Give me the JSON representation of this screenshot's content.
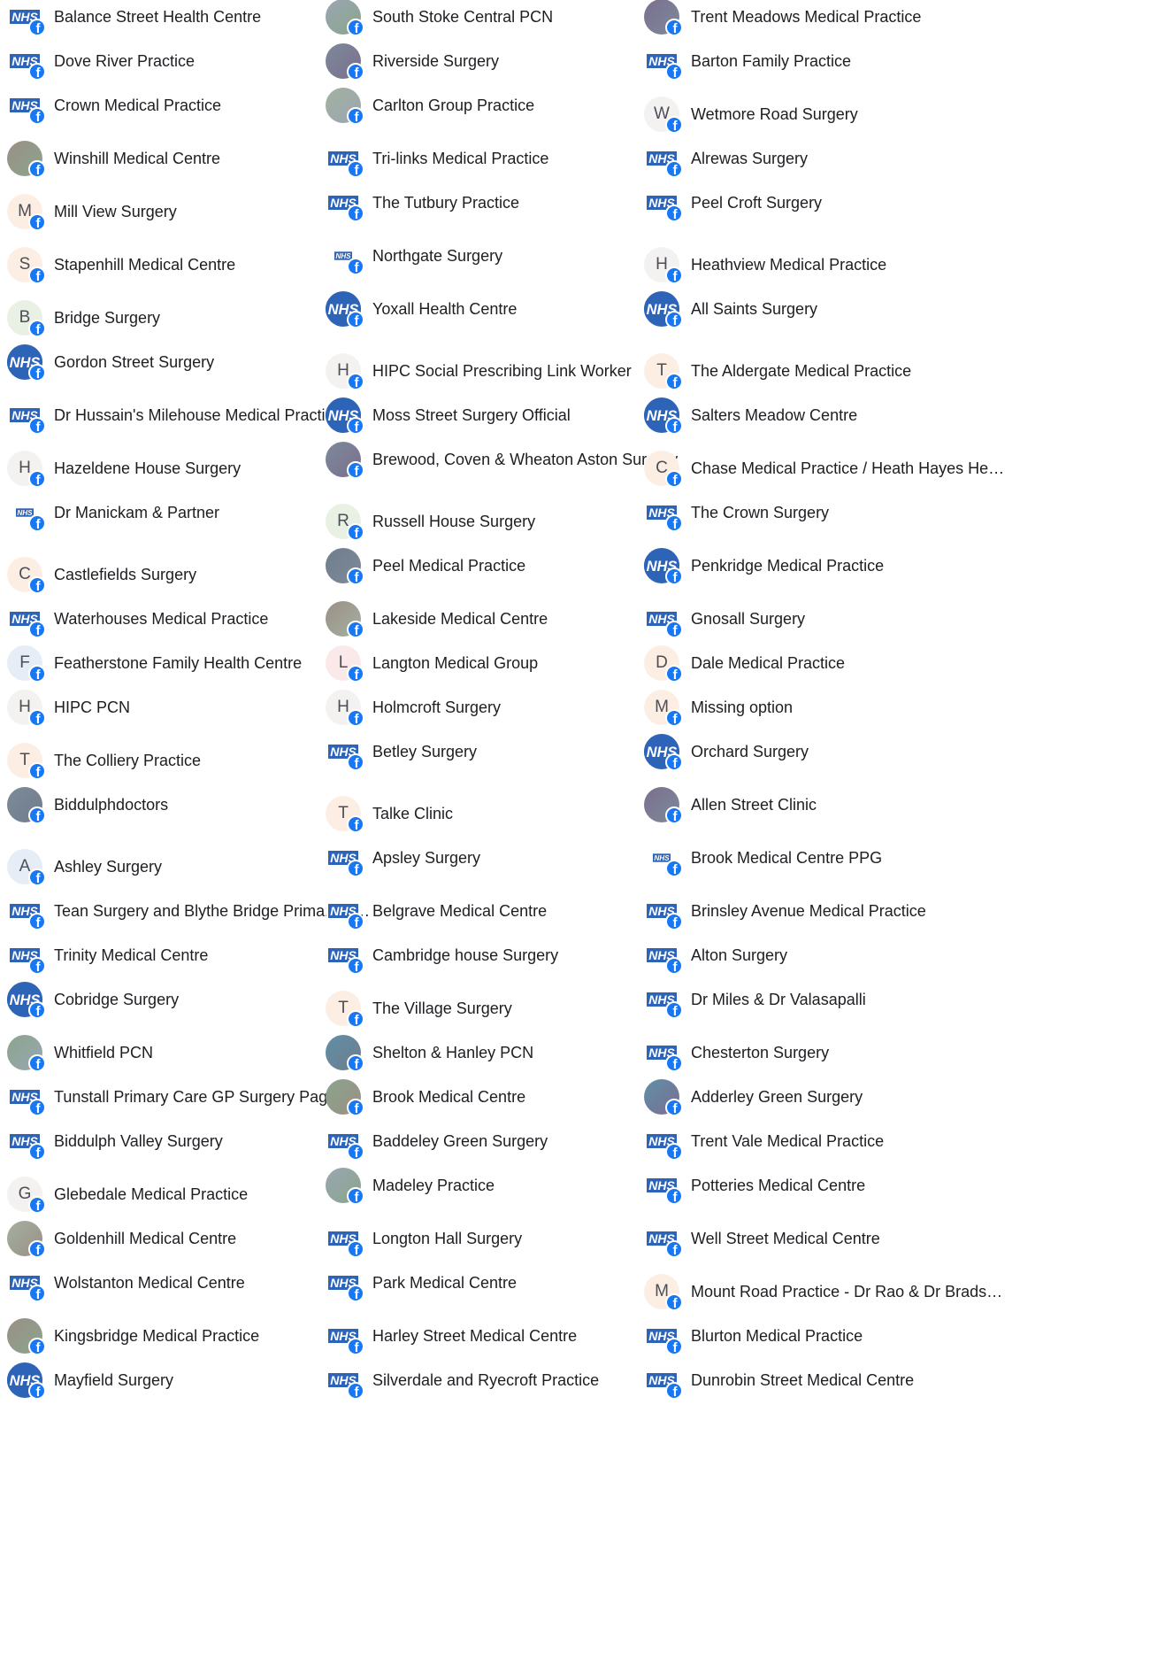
{
  "columns": [
    {
      "items": [
        {
          "label": "Balance Street Health Centre",
          "avatar": "nhs"
        },
        {
          "label": "Dove River Practice",
          "avatar": "nhs"
        },
        {
          "label": "Crown Medical Practice",
          "avatar": "nhs"
        },
        {
          "label": "Winshill Medical Centre",
          "avatar": "photo"
        },
        {
          "label": "Mill View Surgery",
          "avatar": "letter",
          "letter": "M",
          "tone": "warm"
        },
        {
          "label": "Stapenhill Medical Centre",
          "avatar": "letter",
          "letter": "S",
          "tone": "warm"
        },
        {
          "label": "Bridge Surgery",
          "avatar": "letter",
          "letter": "B",
          "tone": "green"
        },
        {
          "label": "Gordon Street Surgery",
          "avatar": "nhs-round"
        },
        {
          "label": "Dr Hussain's Milehouse Medical Practice",
          "avatar": "nhs"
        },
        {
          "label": "Hazeldene House Surgery",
          "avatar": "letter",
          "letter": "H",
          "tone": "grey"
        },
        {
          "label": "Dr Manickam & Partner",
          "avatar": "nhs-small"
        },
        {
          "label": "Castlefields Surgery",
          "avatar": "letter",
          "letter": "C",
          "tone": "warm"
        },
        {
          "label": "Waterhouses Medical Practice",
          "avatar": "nhs"
        },
        {
          "label": "Featherstone Family Health Centre",
          "avatar": "letter",
          "letter": "F",
          "tone": "blue"
        },
        {
          "label": "HIPC PCN",
          "avatar": "letter",
          "letter": "H",
          "tone": "grey"
        },
        {
          "label": "The Colliery Practice",
          "avatar": "letter",
          "letter": "T",
          "tone": "warm"
        },
        {
          "label": "Biddulphdoctors",
          "avatar": "photo"
        },
        {
          "label": "Ashley Surgery",
          "avatar": "letter",
          "letter": "A",
          "tone": "blue"
        },
        {
          "label": "Tean Surgery and Blythe Bridge Primary Care…",
          "avatar": "nhs"
        },
        {
          "label": "Trinity Medical Centre",
          "avatar": "nhs"
        },
        {
          "label": "Cobridge Surgery",
          "avatar": "nhs-round"
        },
        {
          "label": "Whitfield PCN",
          "avatar": "photo"
        },
        {
          "label": "Tunstall Primary Care GP Surgery Page",
          "avatar": "nhs"
        },
        {
          "label": "Biddulph Valley Surgery",
          "avatar": "nhs"
        },
        {
          "label": "Glebedale Medical Practice",
          "avatar": "letter",
          "letter": "G",
          "tone": "grey"
        },
        {
          "label": "Goldenhill Medical Centre",
          "avatar": "photo"
        },
        {
          "label": "Wolstanton Medical Centre",
          "avatar": "nhs"
        },
        {
          "label": "Kingsbridge Medical Practice",
          "avatar": "photo"
        },
        {
          "label": "Mayfield Surgery",
          "avatar": "nhs-round"
        }
      ]
    },
    {
      "items": [
        {
          "label": "South Stoke Central PCN",
          "avatar": "photo"
        },
        {
          "label": "Riverside Surgery",
          "avatar": "photo"
        },
        {
          "label": "Carlton Group Practice",
          "avatar": "photo"
        },
        {
          "label": "Tri-links Medical Practice",
          "avatar": "nhs"
        },
        {
          "label": "The Tutbury Practice",
          "avatar": "nhs"
        },
        {
          "label": "Northgate Surgery",
          "avatar": "nhs-small"
        },
        {
          "label": "Yoxall Health Centre",
          "avatar": "nhs-round"
        },
        {
          "label": "HIPC Social Prescribing Link Worker",
          "avatar": "letter",
          "letter": "H",
          "tone": "grey"
        },
        {
          "label": "Moss Street Surgery Official",
          "avatar": "nhs-round"
        },
        {
          "label": "Brewood, Coven & Wheaton Aston Surgery",
          "avatar": "photo"
        },
        {
          "label": "Russell House Surgery",
          "avatar": "letter",
          "letter": "R",
          "tone": "green"
        },
        {
          "label": "Peel Medical Practice",
          "avatar": "photo"
        },
        {
          "label": "Lakeside Medical Centre",
          "avatar": "photo"
        },
        {
          "label": "Langton Medical Group",
          "avatar": "letter",
          "letter": "L",
          "tone": "pink"
        },
        {
          "label": "Holmcroft Surgery",
          "avatar": "letter",
          "letter": "H",
          "tone": "grey"
        },
        {
          "label": "Betley Surgery",
          "avatar": "nhs"
        },
        {
          "label": "Talke Clinic",
          "avatar": "letter",
          "letter": "T",
          "tone": "warm"
        },
        {
          "label": "Apsley Surgery",
          "avatar": "nhs"
        },
        {
          "label": "Belgrave Medical Centre",
          "avatar": "nhs"
        },
        {
          "label": "Cambridge house Surgery",
          "avatar": "nhs"
        },
        {
          "label": "The Village Surgery",
          "avatar": "letter",
          "letter": "T",
          "tone": "warm"
        },
        {
          "label": "Shelton & Hanley PCN",
          "avatar": "photo"
        },
        {
          "label": "Brook Medical Centre",
          "avatar": "photo"
        },
        {
          "label": "Baddeley Green Surgery",
          "avatar": "nhs"
        },
        {
          "label": "Madeley Practice",
          "avatar": "photo"
        },
        {
          "label": "Longton Hall Surgery",
          "avatar": "nhs"
        },
        {
          "label": "Park Medical Centre",
          "avatar": "nhs"
        },
        {
          "label": "Harley Street Medical Centre",
          "avatar": "nhs"
        },
        {
          "label": "Silverdale and Ryecroft Practice",
          "avatar": "nhs"
        }
      ]
    },
    {
      "items": [
        {
          "label": "Trent Meadows Medical Practice",
          "avatar": "photo"
        },
        {
          "label": "Barton Family Practice",
          "avatar": "nhs"
        },
        {
          "label": "Wetmore Road Surgery",
          "avatar": "letter",
          "letter": "W",
          "tone": "grey"
        },
        {
          "label": "Alrewas Surgery",
          "avatar": "nhs"
        },
        {
          "label": "Peel Croft Surgery",
          "avatar": "nhs"
        },
        {
          "label": "Heathview Medical Practice",
          "avatar": "letter",
          "letter": "H",
          "tone": "grey"
        },
        {
          "label": "All Saints Surgery",
          "avatar": "nhs-round"
        },
        {
          "label": "The Aldergate Medical Practice",
          "avatar": "letter",
          "letter": "T",
          "tone": "warm"
        },
        {
          "label": "Salters Meadow Centre",
          "avatar": "nhs-round"
        },
        {
          "label": "Chase Medical Practice / Heath Hayes Health …",
          "avatar": "letter",
          "letter": "C",
          "tone": "warm"
        },
        {
          "label": "The Crown Surgery",
          "avatar": "nhs"
        },
        {
          "label": "Penkridge Medical Practice",
          "avatar": "nhs-round"
        },
        {
          "label": "Gnosall Surgery",
          "avatar": "nhs"
        },
        {
          "label": "Dale Medical Practice",
          "avatar": "letter",
          "letter": "D",
          "tone": "warm"
        },
        {
          "label": "Missing option",
          "avatar": "letter",
          "letter": "M",
          "tone": "warm"
        },
        {
          "label": "Orchard Surgery",
          "avatar": "nhs-round"
        },
        {
          "label": "Allen Street Clinic",
          "avatar": "photo"
        },
        {
          "label": "Brook Medical Centre PPG",
          "avatar": "nhs-small"
        },
        {
          "label": "Brinsley Avenue Medical Practice",
          "avatar": "nhs"
        },
        {
          "label": "Alton Surgery",
          "avatar": "nhs"
        },
        {
          "label": "Dr Miles & Dr Valasapalli",
          "avatar": "nhs"
        },
        {
          "label": "Chesterton Surgery",
          "avatar": "nhs"
        },
        {
          "label": "Adderley Green Surgery",
          "avatar": "photo"
        },
        {
          "label": "Trent Vale Medical Practice",
          "avatar": "nhs"
        },
        {
          "label": "Potteries Medical Centre",
          "avatar": "nhs"
        },
        {
          "label": "Well Street Medical Centre",
          "avatar": "nhs"
        },
        {
          "label": "Mount Road Practice - Dr Rao & Dr Bradshaw",
          "avatar": "letter",
          "letter": "M",
          "tone": "warm"
        },
        {
          "label": "Blurton Medical Practice",
          "avatar": "nhs"
        },
        {
          "label": "Dunrobin Street Medical Centre",
          "avatar": "nhs"
        }
      ]
    }
  ],
  "badge_glyph": "f",
  "nhs_logo_text": "NHS",
  "colors": {
    "nhs_blue": "#2d64b8",
    "facebook_blue": "#1877f2",
    "text": "#1c1e21"
  }
}
